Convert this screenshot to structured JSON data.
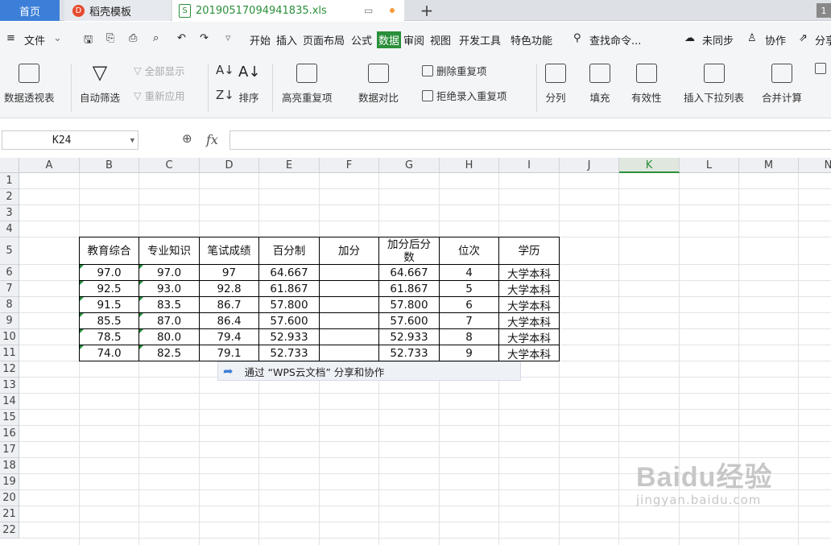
{
  "tabs": {
    "home": "首页",
    "template": "稻壳模板",
    "file": "20190517094941835.xls",
    "badge": "1"
  },
  "menu": {
    "items": [
      "文件",
      "开始",
      "插入",
      "页面布局",
      "公式",
      "数据",
      "审阅",
      "视图",
      "开发工具",
      "特色功能"
    ],
    "search": "查找命令...",
    "sync": "未同步",
    "collab": "协作",
    "share": "分享"
  },
  "ribbon": {
    "pivot": "数据透视表",
    "autofilter": "自动筛选",
    "show_all": "全部显示",
    "reapply": "重新应用",
    "sort": "排序",
    "highlight_dup": "高亮重复项",
    "compare": "数据对比",
    "remove_dup": "删除重复项",
    "reject_dup": "拒绝录入重复项",
    "split": "分列",
    "fill": "填充",
    "validity": "有效性",
    "insert_dropdown": "插入下拉列表",
    "merge_calc": "合并计算"
  },
  "formula_bar": {
    "cell_ref": "K24",
    "fx": "fx",
    "value": ""
  },
  "columns": [
    "A",
    "B",
    "C",
    "D",
    "E",
    "F",
    "G",
    "H",
    "I",
    "J",
    "K",
    "L",
    "M",
    "N"
  ],
  "selected_col": "K",
  "rows": [
    "1",
    "2",
    "3",
    "4",
    "5",
    "6",
    "7",
    "8",
    "9",
    "10",
    "11",
    "12",
    "13",
    "14",
    "15",
    "16",
    "17",
    "18",
    "19",
    "20",
    "21",
    "22"
  ],
  "table": {
    "headers": [
      "教育综合",
      "专业知识",
      "笔试成绩",
      "百分制",
      "加分",
      "加分后分数",
      "位次",
      "学历"
    ],
    "data": [
      [
        "97.0",
        "97.0",
        "97",
        "64.667",
        "",
        "64.667",
        "4",
        "大学本科"
      ],
      [
        "92.5",
        "93.0",
        "92.8",
        "61.867",
        "",
        "61.867",
        "5",
        "大学本科"
      ],
      [
        "91.5",
        "83.5",
        "86.7",
        "57.800",
        "",
        "57.800",
        "6",
        "大学本科"
      ],
      [
        "85.5",
        "87.0",
        "86.4",
        "57.600",
        "",
        "57.600",
        "7",
        "大学本科"
      ],
      [
        "78.5",
        "80.0",
        "79.4",
        "52.933",
        "",
        "52.933",
        "8",
        "大学本科"
      ],
      [
        "74.0",
        "82.5",
        "79.1",
        "52.733",
        "",
        "52.733",
        "9",
        "大学本科"
      ]
    ]
  },
  "share_tip": "通过 “WPS云文档” 分享和协作",
  "watermark": {
    "line1": "Baidu经验",
    "line2": "jingyan.baidu.com"
  },
  "colors": {
    "accent": "#2a8f3a",
    "home_tab": "#3c7fd8"
  }
}
